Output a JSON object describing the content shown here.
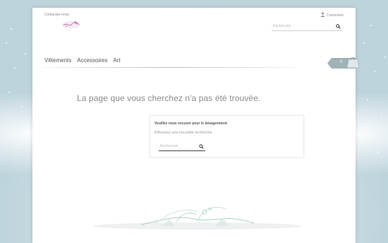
{
  "header": {
    "contact_label": "Contactez-nous",
    "login_label": "Connexion",
    "search_placeholder": "Rechercher"
  },
  "nav": {
    "items": [
      "Vêtements",
      "Accessoires",
      "Art"
    ]
  },
  "cart": {
    "count": "0"
  },
  "main": {
    "title": "La page que vous cherchez n'a pas été trouvée.",
    "sorry": "Veuillez nous excuser pour le désagrément.",
    "try_again": "Effectuez une nouvelle recherche",
    "search_placeholder": "Rechercher"
  },
  "icons": {
    "user": "user-icon",
    "search": "search-icon",
    "cart": "shopping-bag-icon"
  },
  "colors": {
    "accent": "#8fa8ad",
    "cart_tag": "#9fb3b7"
  }
}
